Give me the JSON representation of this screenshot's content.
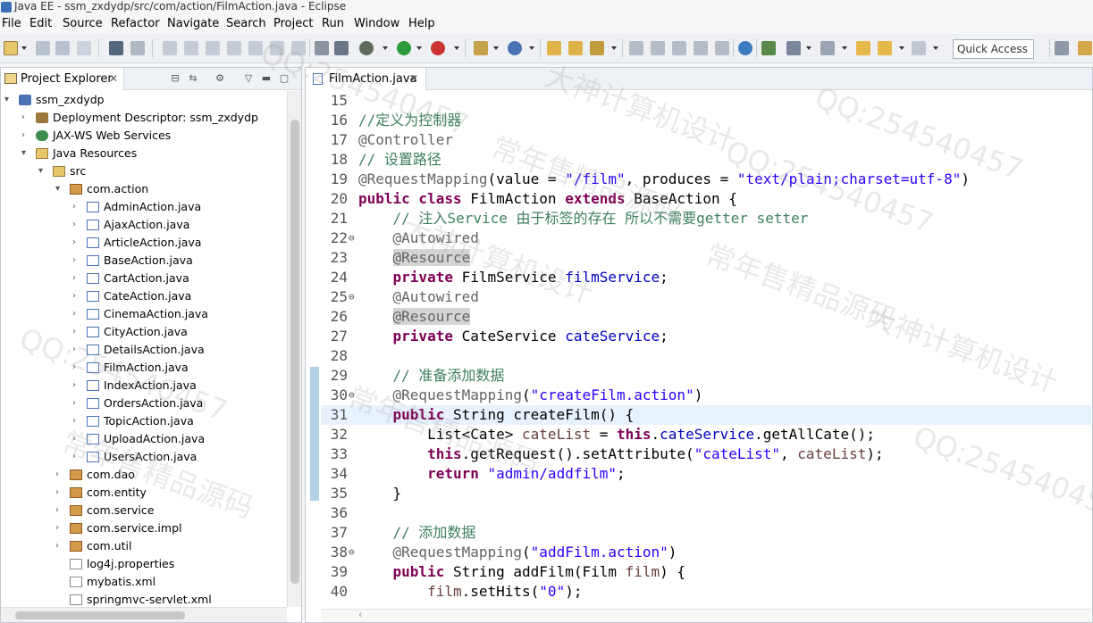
{
  "window": {
    "title": "Java EE - ssm_zxdydp/src/com/action/FilmAction.java - Eclipse"
  },
  "menu": [
    "File",
    "Edit",
    "Source",
    "Refactor",
    "Navigate",
    "Search",
    "Project",
    "Run",
    "Window",
    "Help"
  ],
  "toolbar": {
    "quick_access_placeholder": "Quick Access"
  },
  "project_explorer": {
    "tab_label": "Project Explorer",
    "tree": [
      {
        "label": "ssm_zxdydp",
        "level": 0,
        "expanded": true,
        "icon": "project-icon"
      },
      {
        "label": "Deployment Descriptor: ssm_zxdydp",
        "level": 1,
        "expanded": false,
        "icon": "descriptor-icon"
      },
      {
        "label": "JAX-WS Web Services",
        "level": 1,
        "expanded": false,
        "icon": "web-services-icon"
      },
      {
        "label": "Java Resources",
        "level": 1,
        "expanded": true,
        "icon": "java-resources-icon"
      },
      {
        "label": "src",
        "level": 2,
        "expanded": true,
        "icon": "source-folder-icon"
      },
      {
        "label": "com.action",
        "level": 3,
        "expanded": true,
        "icon": "package-icon"
      },
      {
        "label": "AdminAction.java",
        "level": 4,
        "expanded": false,
        "icon": "java-file-icon"
      },
      {
        "label": "AjaxAction.java",
        "level": 4,
        "expanded": false,
        "icon": "java-file-icon"
      },
      {
        "label": "ArticleAction.java",
        "level": 4,
        "expanded": false,
        "icon": "java-file-icon"
      },
      {
        "label": "BaseAction.java",
        "level": 4,
        "expanded": false,
        "icon": "java-file-icon"
      },
      {
        "label": "CartAction.java",
        "level": 4,
        "expanded": false,
        "icon": "java-file-icon"
      },
      {
        "label": "CateAction.java",
        "level": 4,
        "expanded": false,
        "icon": "java-file-icon"
      },
      {
        "label": "CinemaAction.java",
        "level": 4,
        "expanded": false,
        "icon": "java-file-icon"
      },
      {
        "label": "CityAction.java",
        "level": 4,
        "expanded": false,
        "icon": "java-file-icon"
      },
      {
        "label": "DetailsAction.java",
        "level": 4,
        "expanded": false,
        "icon": "java-file-icon"
      },
      {
        "label": "FilmAction.java",
        "level": 4,
        "expanded": false,
        "icon": "java-file-icon"
      },
      {
        "label": "IndexAction.java",
        "level": 4,
        "expanded": false,
        "icon": "java-file-icon"
      },
      {
        "label": "OrdersAction.java",
        "level": 4,
        "expanded": false,
        "icon": "java-file-icon"
      },
      {
        "label": "TopicAction.java",
        "level": 4,
        "expanded": false,
        "icon": "java-file-icon"
      },
      {
        "label": "UploadAction.java",
        "level": 4,
        "expanded": false,
        "icon": "java-file-icon"
      },
      {
        "label": "UsersAction.java",
        "level": 4,
        "expanded": false,
        "icon": "java-file-icon"
      },
      {
        "label": "com.dao",
        "level": 3,
        "expanded": false,
        "icon": "package-icon"
      },
      {
        "label": "com.entity",
        "level": 3,
        "expanded": false,
        "icon": "package-icon"
      },
      {
        "label": "com.service",
        "level": 3,
        "expanded": false,
        "icon": "package-icon"
      },
      {
        "label": "com.service.impl",
        "level": 3,
        "expanded": false,
        "icon": "package-icon"
      },
      {
        "label": "com.util",
        "level": 3,
        "expanded": false,
        "icon": "package-icon"
      },
      {
        "label": "log4j.properties",
        "level": 3,
        "leaf": true,
        "icon": "file-icon"
      },
      {
        "label": "mybatis.xml",
        "level": 3,
        "leaf": true,
        "icon": "xml-file-icon"
      },
      {
        "label": "springmvc-servlet.xml",
        "level": 3,
        "leaf": true,
        "icon": "xml-file-icon"
      }
    ]
  },
  "editor": {
    "tab_label": "FilmAction.java",
    "current_line": 31,
    "lines": [
      {
        "n": "15",
        "fold": false,
        "tokens": []
      },
      {
        "n": "16",
        "fold": false,
        "tokens": [
          [
            "cmt",
            "//定义为控制器"
          ]
        ]
      },
      {
        "n": "17",
        "fold": false,
        "tokens": [
          [
            "ann",
            "@Controller"
          ]
        ]
      },
      {
        "n": "18",
        "fold": false,
        "tokens": [
          [
            "cmt",
            "// 设置路径"
          ]
        ]
      },
      {
        "n": "19",
        "fold": false,
        "tokens": [
          [
            "ann",
            "@RequestMapping"
          ],
          [
            "",
            "(value = "
          ],
          [
            "str",
            "\"/film\""
          ],
          [
            "",
            ", produces = "
          ],
          [
            "str",
            "\"text/plain;charset=utf-8\""
          ],
          [
            "",
            ")"
          ]
        ]
      },
      {
        "n": "20",
        "fold": false,
        "tokens": [
          [
            "kw",
            "public class"
          ],
          [
            "",
            " FilmAction "
          ],
          [
            "kw",
            "extends"
          ],
          [
            "",
            " BaseAction {"
          ]
        ]
      },
      {
        "n": "21",
        "fold": false,
        "tokens": [
          [
            "",
            "    "
          ],
          [
            "cmt",
            "// 注入Service 由于标签的存在 所以不需要getter setter"
          ]
        ]
      },
      {
        "n": "22",
        "fold": true,
        "tokens": [
          [
            "",
            "    "
          ],
          [
            "ann",
            "@Autowired"
          ]
        ]
      },
      {
        "n": "23",
        "fold": false,
        "tokens": [
          [
            "",
            "    "
          ],
          [
            "ann-hl",
            "@Resource"
          ]
        ]
      },
      {
        "n": "24",
        "fold": false,
        "tokens": [
          [
            "",
            "    "
          ],
          [
            "kw",
            "private"
          ],
          [
            "",
            " FilmService "
          ],
          [
            "fld",
            "filmService"
          ],
          [
            "",
            ";"
          ]
        ]
      },
      {
        "n": "25",
        "fold": true,
        "tokens": [
          [
            "",
            "    "
          ],
          [
            "ann",
            "@Autowired"
          ]
        ]
      },
      {
        "n": "26",
        "fold": false,
        "tokens": [
          [
            "",
            "    "
          ],
          [
            "ann-hl",
            "@Resource"
          ]
        ]
      },
      {
        "n": "27",
        "fold": false,
        "tokens": [
          [
            "",
            "    "
          ],
          [
            "kw",
            "private"
          ],
          [
            "",
            " CateService "
          ],
          [
            "fld",
            "cateService"
          ],
          [
            "",
            ";"
          ]
        ]
      },
      {
        "n": "28",
        "fold": false,
        "tokens": []
      },
      {
        "n": "29",
        "fold": false,
        "tokens": [
          [
            "",
            "    "
          ],
          [
            "cmt",
            "// 准备添加数据"
          ]
        ]
      },
      {
        "n": "30",
        "fold": true,
        "tokens": [
          [
            "",
            "    "
          ],
          [
            "ann",
            "@RequestMapping"
          ],
          [
            "",
            "("
          ],
          [
            "str",
            "\"createFilm.action\""
          ],
          [
            "",
            ")"
          ]
        ]
      },
      {
        "n": "31",
        "fold": false,
        "tokens": [
          [
            "",
            "    "
          ],
          [
            "kw",
            "public"
          ],
          [
            "",
            " String createFilm() {"
          ]
        ]
      },
      {
        "n": "32",
        "fold": false,
        "tokens": [
          [
            "",
            "        List<Cate> "
          ],
          [
            "var",
            "cateList"
          ],
          [
            "",
            " = "
          ],
          [
            "kw",
            "this"
          ],
          [
            "",
            "."
          ],
          [
            "fld",
            "cateService"
          ],
          [
            "",
            ".getAllCate();"
          ]
        ]
      },
      {
        "n": "33",
        "fold": false,
        "tokens": [
          [
            "",
            "        "
          ],
          [
            "kw",
            "this"
          ],
          [
            "",
            ".getRequest().setAttribute("
          ],
          [
            "str",
            "\"cateList\""
          ],
          [
            "",
            ", "
          ],
          [
            "var",
            "cateList"
          ],
          [
            "",
            ");"
          ]
        ]
      },
      {
        "n": "34",
        "fold": false,
        "tokens": [
          [
            "",
            "        "
          ],
          [
            "kw",
            "return"
          ],
          [
            "",
            " "
          ],
          [
            "str",
            "\"admin/addfilm\""
          ],
          [
            "",
            ";"
          ]
        ]
      },
      {
        "n": "35",
        "fold": false,
        "tokens": [
          [
            "",
            "    }"
          ]
        ]
      },
      {
        "n": "36",
        "fold": false,
        "tokens": []
      },
      {
        "n": "37",
        "fold": false,
        "tokens": [
          [
            "",
            "    "
          ],
          [
            "cmt",
            "// 添加数据"
          ]
        ]
      },
      {
        "n": "38",
        "fold": true,
        "tokens": [
          [
            "",
            "    "
          ],
          [
            "ann",
            "@RequestMapping"
          ],
          [
            "",
            "("
          ],
          [
            "str",
            "\"addFilm.action\""
          ],
          [
            "",
            ")"
          ]
        ]
      },
      {
        "n": "39",
        "fold": false,
        "tokens": [
          [
            "",
            "    "
          ],
          [
            "kw",
            "public"
          ],
          [
            "",
            " String addFilm(Film "
          ],
          [
            "var",
            "film"
          ],
          [
            "",
            ") {"
          ]
        ]
      },
      {
        "n": "40",
        "fold": false,
        "tokens": [
          [
            "",
            "        "
          ],
          [
            "var",
            "film"
          ],
          [
            "",
            ".setHits("
          ],
          [
            "str",
            "\"0\""
          ],
          [
            "",
            ");"
          ]
        ]
      }
    ]
  },
  "watermarks": [
    "QQ:254540457",
    "常年售精品源码",
    "大神计算机设计",
    "QQ:254540457",
    "常年售精品源码",
    "QQ:254540457",
    "大神计算机设计",
    "常年售精品源码",
    "QQ:254540457",
    "大神计算机设计",
    "QQ:254540457",
    "常年售精品源码"
  ],
  "colors": {
    "accent": "#4a73b5",
    "keyword": "#7f0055",
    "string": "#2a00ff",
    "comment": "#3f7f5f",
    "current_line": "#e8f2fe"
  }
}
